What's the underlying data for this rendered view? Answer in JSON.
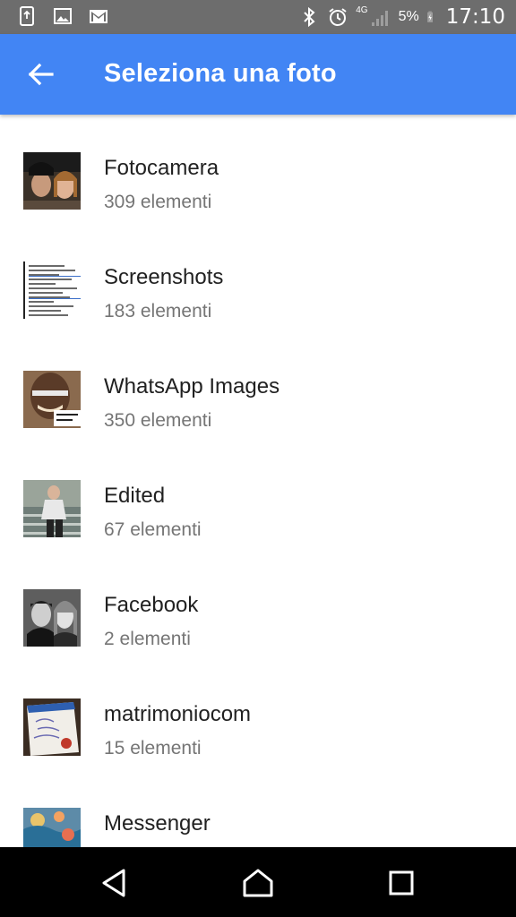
{
  "status_bar": {
    "time": "17:10",
    "battery_percent": "5%",
    "network": "4G",
    "left_icons": [
      "screenshot-icon",
      "image-icon",
      "gmail-icon"
    ],
    "right_icons": [
      "bluetooth-icon",
      "alarm-icon",
      "signal-icon",
      "battery-charging-icon"
    ]
  },
  "app_bar": {
    "title": "Seleziona una foto",
    "back_icon": "arrow-back-icon",
    "color": "#4285f4"
  },
  "albums": [
    {
      "name": "Fotocamera",
      "count": "309 elementi"
    },
    {
      "name": "Screenshots",
      "count": "183 elementi"
    },
    {
      "name": "WhatsApp Images",
      "count": "350 elementi"
    },
    {
      "name": "Edited",
      "count": "67 elementi"
    },
    {
      "name": "Facebook",
      "count": "2 elementi"
    },
    {
      "name": "matrimoniocom",
      "count": "15 elementi"
    },
    {
      "name": "Messenger",
      "count": ""
    }
  ],
  "nav_bar": {
    "buttons": [
      "back-triangle-icon",
      "home-icon",
      "recents-icon"
    ]
  }
}
